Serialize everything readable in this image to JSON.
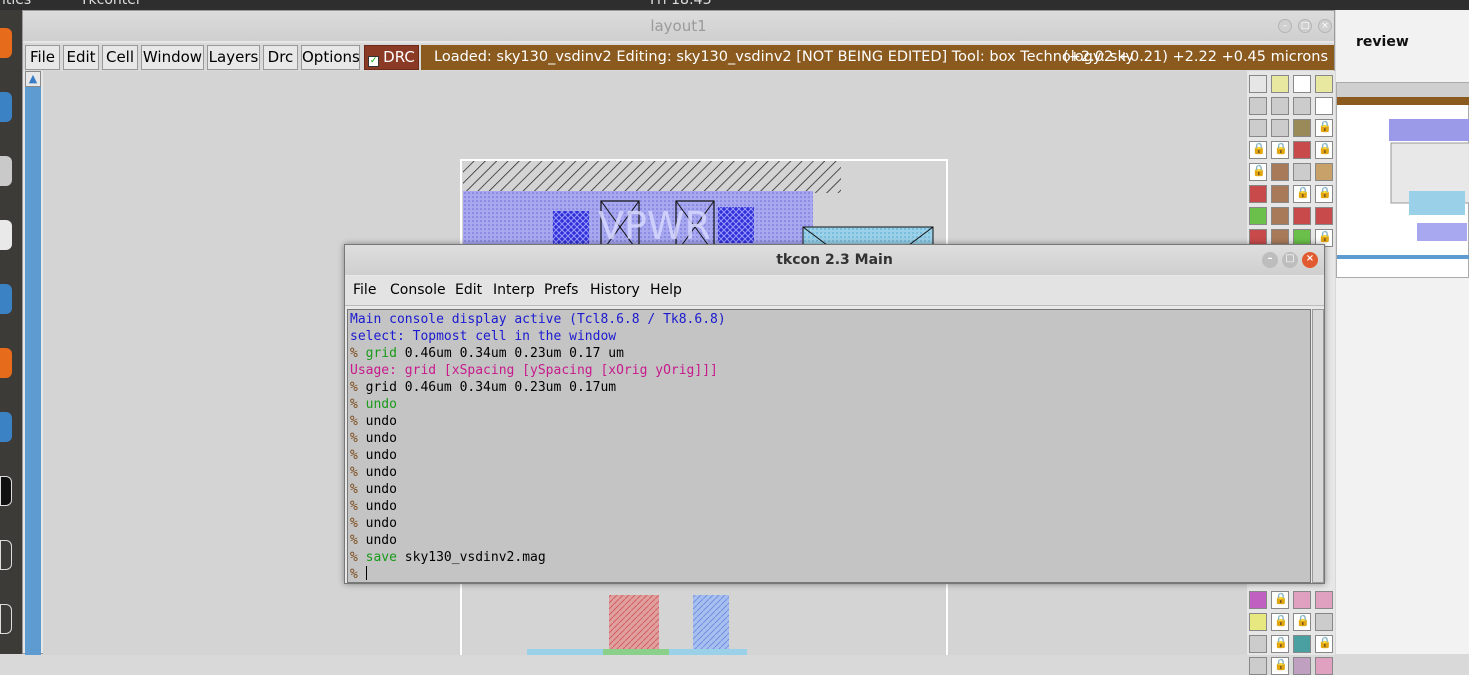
{
  "desktop": {
    "topbar_left": "ities",
    "topbar_app": "Tkconter",
    "topbar_clock": "Fri 18:43"
  },
  "magic": {
    "title": "layout1",
    "menu": [
      "File",
      "Edit",
      "Cell",
      "Window",
      "Layers",
      "Drc",
      "Options"
    ],
    "drc_label": "DRC",
    "status": "Loaded: sky130_vsdinv2 Editing: sky130_vsdinv2 [NOT BEING EDITED] Tool: box  Technology: sky",
    "coords": "(+2.02 +0.21) +2.22 +0.45 microns",
    "layout_label": "VPWR"
  },
  "tkcon": {
    "title": "tkcon 2.3 Main",
    "menu": [
      "File",
      "Console",
      "Edit",
      "Interp",
      "Prefs",
      "History",
      "Help"
    ],
    "lines": [
      {
        "prompt": "",
        "cmd": "",
        "rest": "Main console display active (Tcl8.6.8 / Tk8.6.8)",
        "cls": "blue"
      },
      {
        "prompt": "",
        "cmd": "",
        "rest": "select: Topmost cell in the window",
        "cls": "blue"
      },
      {
        "prompt": "% ",
        "cmd": "grid",
        "rest": " 0.46um 0.34um 0.23um 0.17 um",
        "cls": ""
      },
      {
        "prompt": "",
        "cmd": "",
        "rest": "Usage: grid [xSpacing [ySpacing [xOrig yOrig]]]",
        "cls": "mag"
      },
      {
        "prompt": "% ",
        "cmd": "",
        "rest": "grid 0.46um 0.34um 0.23um 0.17um",
        "cls": ""
      },
      {
        "prompt": "% ",
        "cmd": "undo",
        "rest": "",
        "cls": ""
      },
      {
        "prompt": "% ",
        "cmd": "",
        "rest": "undo",
        "cls": ""
      },
      {
        "prompt": "% ",
        "cmd": "",
        "rest": "undo",
        "cls": ""
      },
      {
        "prompt": "% ",
        "cmd": "",
        "rest": "undo",
        "cls": ""
      },
      {
        "prompt": "% ",
        "cmd": "",
        "rest": "undo",
        "cls": ""
      },
      {
        "prompt": "% ",
        "cmd": "",
        "rest": "undo",
        "cls": ""
      },
      {
        "prompt": "% ",
        "cmd": "",
        "rest": "undo",
        "cls": ""
      },
      {
        "prompt": "% ",
        "cmd": "",
        "rest": "undo",
        "cls": ""
      },
      {
        "prompt": "% ",
        "cmd": "",
        "rest": "undo",
        "cls": ""
      },
      {
        "prompt": "% ",
        "cmd": "save",
        "rest": " sky130_vsdinv2.mag",
        "cls": ""
      },
      {
        "prompt": "% ",
        "cmd": "",
        "rest": "",
        "cls": "cursor"
      }
    ]
  },
  "preview": {
    "title": "review"
  },
  "colors": {
    "status_bg": "#8b5a1e",
    "drc_bg": "#8b3a26",
    "prompt": "#7a4a1a",
    "cmd": "#1a9a1a",
    "info": "#1a1ad0",
    "error": "#c81a8c"
  }
}
